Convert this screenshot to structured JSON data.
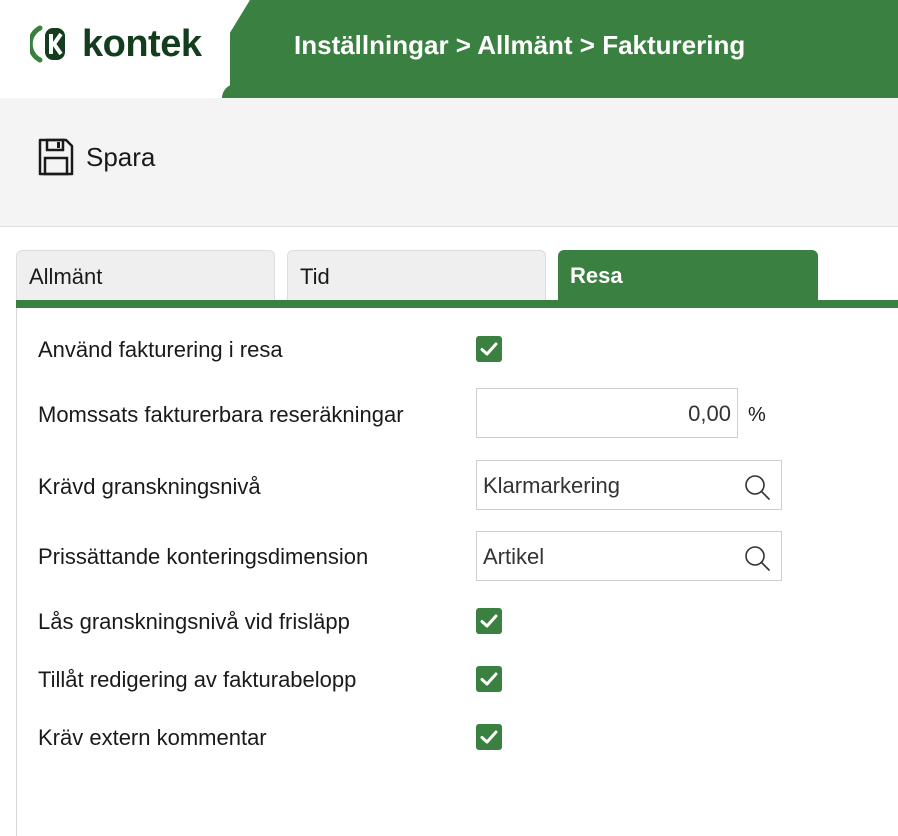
{
  "header": {
    "logo_text": "kontek",
    "breadcrumb": "Inställningar > Allmänt > Fakturering"
  },
  "toolbar": {
    "save_label": "Spara",
    "save_icon": "floppy-disk-icon"
  },
  "tabs": [
    {
      "label": "Allmänt",
      "active": false
    },
    {
      "label": "Tid",
      "active": false
    },
    {
      "label": "Resa",
      "active": true
    }
  ],
  "form": {
    "use_billing": {
      "label": "Använd fakturering i resa",
      "checked": true
    },
    "vat_rate": {
      "label": "Momssats fakturerbara reseräkningar",
      "value": "0,00",
      "unit": "%"
    },
    "review_level": {
      "label": "Krävd granskningsnivå",
      "value": "Klarmarkering"
    },
    "pricing_dimension": {
      "label": "Prissättande konteringsdimension",
      "value": "Artikel"
    },
    "lock_review_level": {
      "label": "Lås granskningsnivå vid frisläpp",
      "checked": true
    },
    "allow_edit_amount": {
      "label": "Tillåt redigering av fakturabelopp",
      "checked": true
    },
    "require_external_comment": {
      "label": "Kräv extern kommentar",
      "checked": true
    }
  },
  "colors": {
    "brand_green": "#3a8040",
    "logo_dark": "#143d1e"
  }
}
